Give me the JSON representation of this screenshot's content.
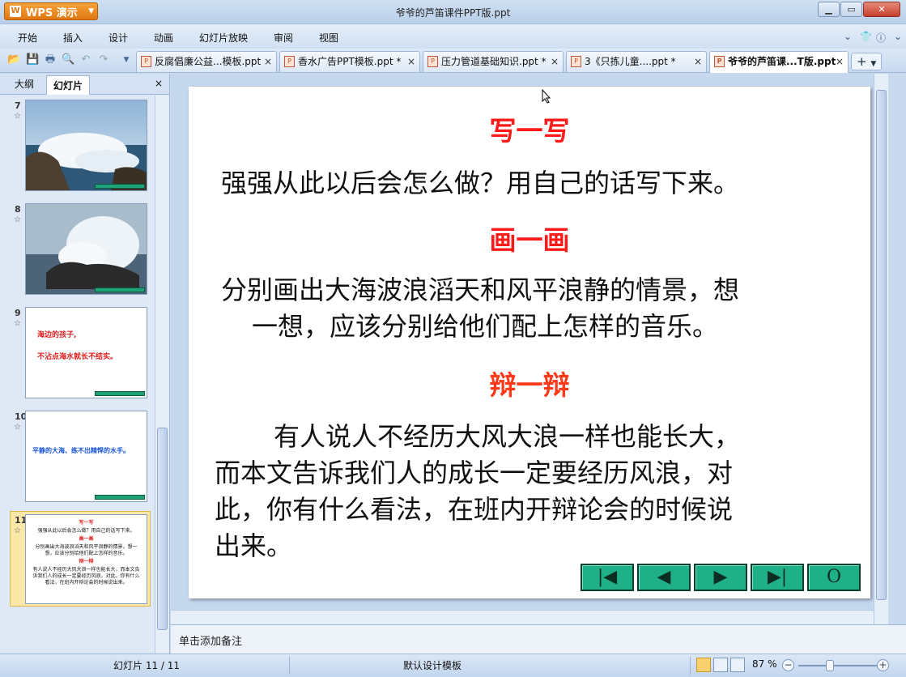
{
  "app": {
    "name": "WPS 演示",
    "window_title": "爷爷的芦笛课件PPT版.ppt"
  },
  "menu": [
    "开始",
    "插入",
    "设计",
    "动画",
    "幻灯片放映",
    "审阅",
    "视图"
  ],
  "doc_tabs": [
    {
      "label": "反腐倡廉公益...模板.ppt",
      "close": "×"
    },
    {
      "label": "香水广告PPT模板.ppt *",
      "close": "×"
    },
    {
      "label": "压力管道基础知识.ppt *",
      "close": "×"
    },
    {
      "label": "3《只拣儿童....ppt *",
      "close": "×"
    },
    {
      "label": "爷爷的芦笛课...T版.ppt",
      "close": "×"
    }
  ],
  "panel": {
    "tab_outline": "大纲",
    "tab_slides": "幻灯片",
    "close": "×"
  },
  "thumbnails": [
    {
      "num": "7"
    },
    {
      "num": "8"
    },
    {
      "num": "9",
      "line1": "海边的孩子,",
      "line2": "不沾点海水就长不结实。"
    },
    {
      "num": "10",
      "line1": "平静的大海、练不出精悍的水手。"
    },
    {
      "num": "11",
      "h1": "写一写",
      "p1": "强强从此以后会怎么做？用自己的话写下来。",
      "h2": "画一画",
      "p2": "分别画出大海波浪滔天和风平浪静的情景，想一想，应该分别给他们配上怎样的音乐。",
      "h3": "辩一辩",
      "p3": "有人说人不经历大风大浪一样也能长大，而本文告诉我们人的成长一定要经历风浪，对此，你有什么看法，在班内开辩论会的时候说出来。"
    }
  ],
  "slide": {
    "heading1": "写一写",
    "para1": "强强从此以后会怎么做？用自己的话写下来。",
    "heading2": "画一画",
    "para2_line1": "分别画出大海波浪滔天和风平浪静的情景，想",
    "para2_line2": "一想，应该分别给他们配上怎样的音乐。",
    "heading3": "辩一辩",
    "para3_line1": "有人说人不经历大风大浪一样也能长大，",
    "para3_line2": "而本文告诉我们人的成长一定要经历风浪，对",
    "para3_line3": "此，你有什么看法，在班内开辩论会的时候说",
    "para3_line4": "出来。",
    "nav_buttons": [
      "|◀",
      "◀",
      "▶",
      "▶|",
      "O"
    ]
  },
  "notes_placeholder": "单击添加备注",
  "status": {
    "slide_counter": "幻灯片 11 / 11",
    "template": "默认设计模板",
    "zoom": "87 %"
  },
  "colors": {
    "heading_red": "#ff1a1a",
    "nav_green": "#1fb088",
    "accent_orange": "#e07712"
  }
}
